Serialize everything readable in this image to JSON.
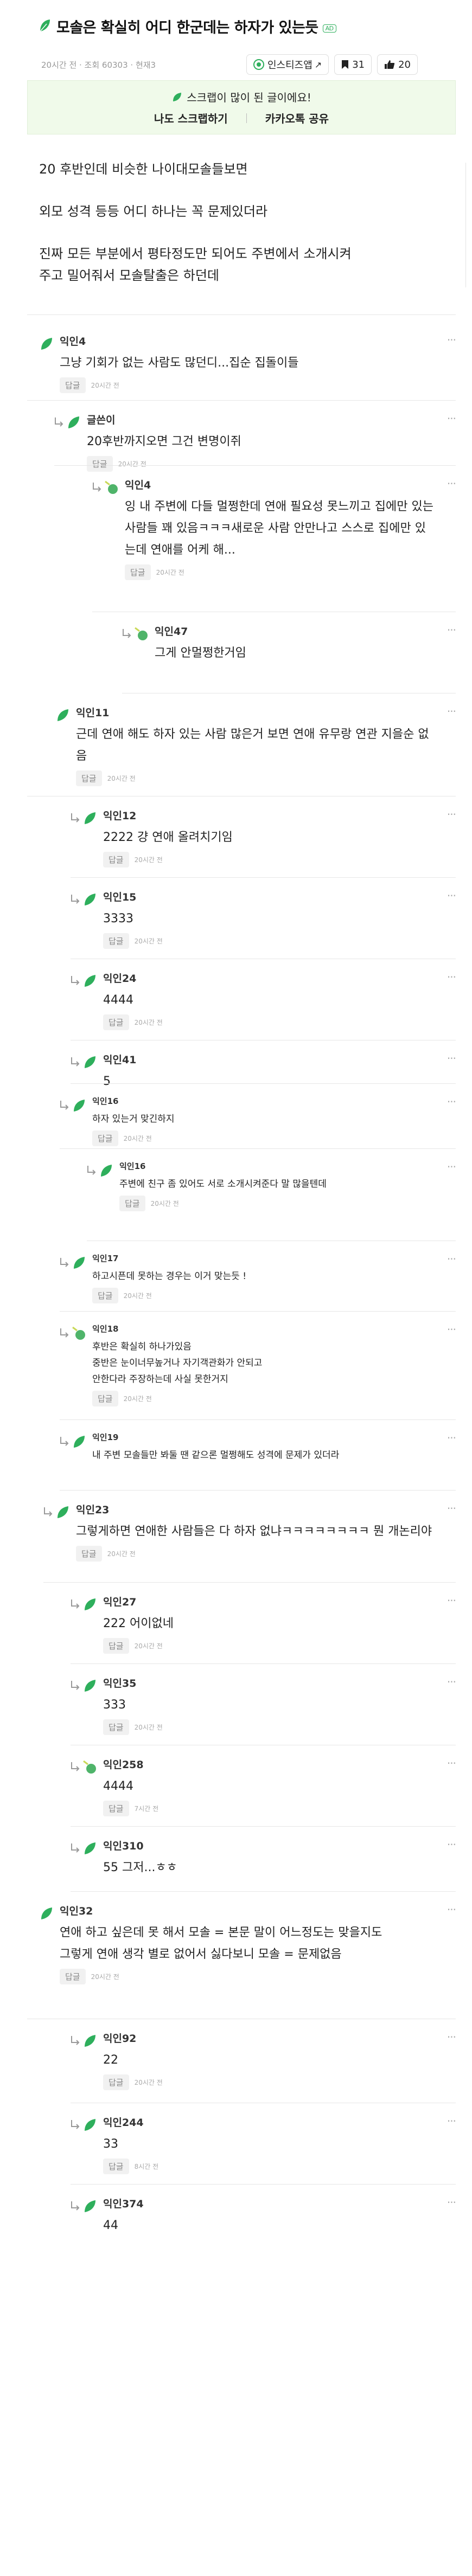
{
  "post": {
    "title": "모솔은 확실히 어디 한군데는 하자가 있는듯",
    "badge": "AD",
    "meta": "20시간 전 · 조회 60303 · 현재3",
    "insta_label": "인스티즈앱",
    "scrap_count": "31",
    "like_count": "20"
  },
  "banner": {
    "text": "스크랩이 많이 된 글이에요!",
    "scrap_link": "나도 스크랩하기",
    "share_link": "카카오톡 공유"
  },
  "article": {
    "paragraphs": [
      "20 후반인데 비슷한 나이대모솔들보면",
      "외모 성격 등등 어디 하나는 꼭 문제있더라",
      "진짜 모든 부분에서 평타정도만 되어도 주변에서 소개시켜\n주고 밀어줘서 모솔탈출은 하던데"
    ]
  },
  "comments": [
    {
      "name": "익인4",
      "body": "그냥 기회가 없는 사람도 많던디...집순 집돌이들",
      "reply": "답글",
      "time": "20시간 전"
    },
    {
      "name": "글쓴이",
      "body": "20후반까지오면 그건 변명이쥐",
      "reply": "답글",
      "time": "20시간 전"
    },
    {
      "name": "익인4",
      "body": "잉 내 주변에 다들 멀쩡한데 연애 필요성 못느끼고 집에만 있는 사람들 꽤 있음ㅋㅋㅋ새로운 사람 안만나고 스스로 집에만 있는데 연애를 어케 해...",
      "reply": "답글",
      "time": "20시간 전"
    },
    {
      "name": "익인47",
      "body": "그게 안멀쩡한거임",
      "reply": "",
      "time": ""
    },
    {
      "name": "익인11",
      "body": "근데 연애 해도 하자 있는 사람 많은거 보면 연애 유무랑 연관 지을순 없음",
      "reply": "답글",
      "time": "20시간 전"
    },
    {
      "name": "익인12",
      "body": "2222 걍 연애 올려치기임",
      "reply": "답글",
      "time": "20시간 전"
    },
    {
      "name": "익인15",
      "body": "3333",
      "reply": "답글",
      "time": "20시간 전"
    },
    {
      "name": "익인24",
      "body": "4444",
      "reply": "답글",
      "time": "20시간 전"
    },
    {
      "name": "익인41",
      "body": "5",
      "reply": "",
      "time": ""
    },
    {
      "name": "익인16",
      "body": "하자 있는거 맞긴하지",
      "reply": "답글",
      "time": "20시간 전"
    },
    {
      "name": "익인16",
      "body": "주변에 친구 좀 있어도 서로 소개시켜준다 말 많을텐데",
      "reply": "답글",
      "time": "20시간 전"
    },
    {
      "name": "익인17",
      "body": "하고시픈데 못하는 경우는 이거 맞는듯 !",
      "reply": "답글",
      "time": "20시간 전"
    },
    {
      "name": "익인18",
      "body": "후반은 확실히 하나가있음\n중반은 눈이너무높거나 자기객관화가 안되고\n안한다라 주장하는데 사실 못한거지",
      "reply": "답글",
      "time": "20시간 전"
    },
    {
      "name": "익인19",
      "body": "내 주변 모솔들만 봐둘 땐 같으론 멀쩡해도 성격에 문제가 있더라",
      "reply": "",
      "time": ""
    },
    {
      "name": "익인23",
      "body": "그렇게하면 연애한 사람들은 다 하자 없냐ㅋㅋㅋㅋㅋㅋㅋㅋ 뭔 개논리야",
      "reply": "답글",
      "time": "20시간 전"
    },
    {
      "name": "익인27",
      "body": "222 어이없네",
      "reply": "답글",
      "time": "20시간 전"
    },
    {
      "name": "익인35",
      "body": "333",
      "reply": "답글",
      "time": "20시간 전"
    },
    {
      "name": "익인258",
      "body": "4444",
      "reply": "답글",
      "time": "7시간 전"
    },
    {
      "name": "익인310",
      "body": "55 그저...ㅎㅎ",
      "reply": "",
      "time": ""
    },
    {
      "name": "익인32",
      "body": "연애 하고 싶은데 못 해서 모솔 = 본문 말이 어느정도는 맞을지도\n그렇게 연애 생각 별로 없어서 싫다보니 모솔 = 문제없음",
      "reply": "답글",
      "time": "20시간 전"
    },
    {
      "name": "익인92",
      "body": "22",
      "reply": "답글",
      "time": "20시간 전"
    },
    {
      "name": "익인244",
      "body": "33",
      "reply": "답글",
      "time": "8시간 전"
    },
    {
      "name": "익인374",
      "body": "44",
      "reply": "",
      "time": ""
    }
  ],
  "colors": {
    "accent": "#2eaf5c",
    "banner_bg": "#f0faea"
  },
  "icons": [
    "leaf-icon",
    "insta-icon",
    "bookmark-icon",
    "thumbs-up-icon",
    "reply-arrow-icon",
    "leaf-avatar-icon",
    "more-icon"
  ]
}
